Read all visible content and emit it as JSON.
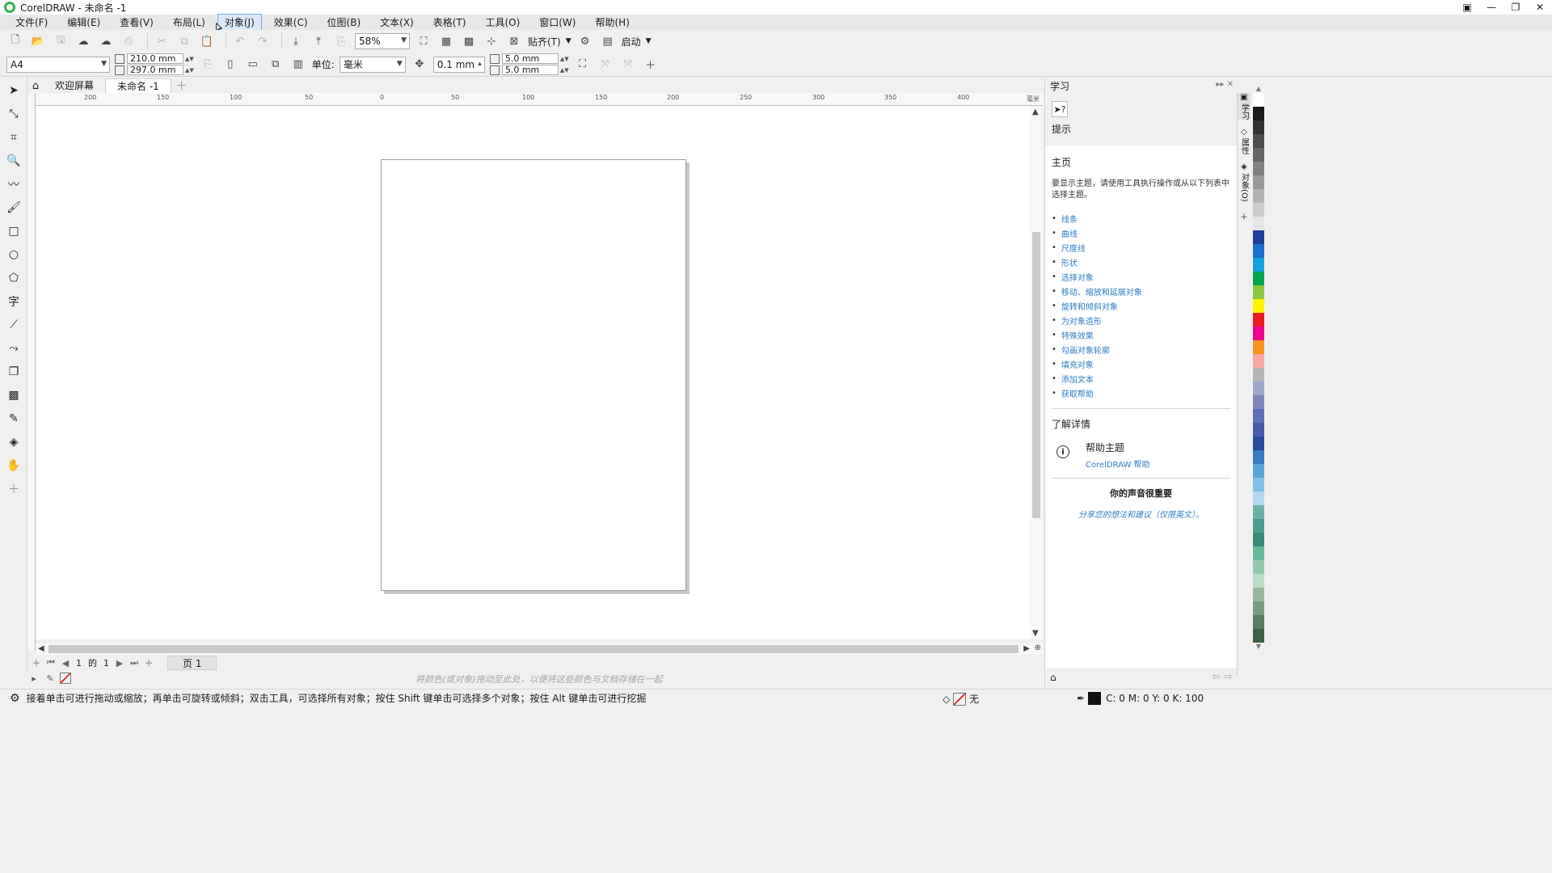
{
  "window": {
    "title": "CorelDRAW - 未命名 -1",
    "controls": [
      "▣",
      "—",
      "❐",
      "✕"
    ]
  },
  "menu": [
    "文件(F)",
    "编辑(E)",
    "查看(V)",
    "布局(L)",
    "对象(J)",
    "效果(C)",
    "位图(B)",
    "文本(X)",
    "表格(T)",
    "工具(O)",
    "窗口(W)",
    "帮助(H)"
  ],
  "toolbar": {
    "zoom": "58%",
    "snap_label": "贴齐(T)",
    "launch_label": "启动"
  },
  "property_bar": {
    "page_size": "A4",
    "width": "210.0 mm",
    "height": "297.0 mm",
    "unit_label": "单位:",
    "unit_value": "毫米",
    "nudge": "0.1 mm",
    "dup_x": "5.0 mm",
    "dup_y": "5.0 mm"
  },
  "tabs": {
    "welcome": "欢迎屏幕",
    "document": "未命名 -1"
  },
  "ruler": {
    "h_labels": [
      "200",
      "150",
      "100",
      "50",
      "0",
      "50",
      "100",
      "150",
      "200",
      "250",
      "300",
      "350",
      "400"
    ],
    "unit": "毫米"
  },
  "page_nav": {
    "current": "1",
    "of_label": "的",
    "total": "1",
    "page_tab": "页 1"
  },
  "color_bar": {
    "hint": "将颜色(或对象)拖动至此处，以便将这些颜色与文档存储在一起"
  },
  "status": {
    "text": "接着单击可进行拖动或缩放；再单击可旋转或倾斜；双击工具，可选择所有对象；按住 Shift 键单击可选择多个对象；按住 Alt 键单击可进行挖掘",
    "fill_label": "无",
    "outline_cmyk": "C: 0 M: 0 Y: 0 K: 100"
  },
  "docker": {
    "title": "学习",
    "hint_label": "提示",
    "home_title": "主页",
    "home_desc": "要显示主题，请使用工具执行操作或从以下列表中选择主题。",
    "topics": [
      "线条",
      "曲线",
      "尺度线",
      "形状",
      "选择对象",
      "移动、缩放和延展对象",
      "旋转和倾斜对象",
      "为对象造形",
      "特殊效果",
      "勾画对象轮廓",
      "填充对象",
      "添加文本",
      "获取帮助"
    ],
    "more_title": "了解详情",
    "help_title": "帮助主题",
    "help_sub": "CorelDRAW 帮助",
    "voice_title": "你的声音很重要",
    "voice_sub": "分享您的想法和建议（仅限英文）。",
    "side_tabs": [
      "学习",
      "属性",
      "对象(O)"
    ]
  },
  "palette": {
    "colors": [
      "#ffffff",
      "#1a1a1a",
      "#333333",
      "#4d4d4d",
      "#666666",
      "#808080",
      "#999999",
      "#b3b3b3",
      "#cccccc",
      "#e6e6e6",
      "#1f3d99",
      "#1d6fd1",
      "#15a0e3",
      "#00a651",
      "#8dc63f",
      "#fff200",
      "#ed1c24",
      "#ec008c",
      "#f7941d",
      "#f6a7a0",
      "#b5b5b5",
      "#9ea6c9",
      "#7e86bb",
      "#5f6eb3",
      "#4a5aa8",
      "#2b4a9b",
      "#3a7bbf",
      "#5ba4d6",
      "#82c0e6",
      "#b3d7ee",
      "#6fb0a6",
      "#4f9c8e",
      "#3a8a7a",
      "#6ab79c",
      "#95c9ae",
      "#bddcc7",
      "#9ab6a0",
      "#7a9c80",
      "#5a7d62",
      "#3d6048"
    ]
  },
  "colors": {
    "accent_link": "#2d7bc4",
    "active_menu": "#dbe8f6"
  }
}
